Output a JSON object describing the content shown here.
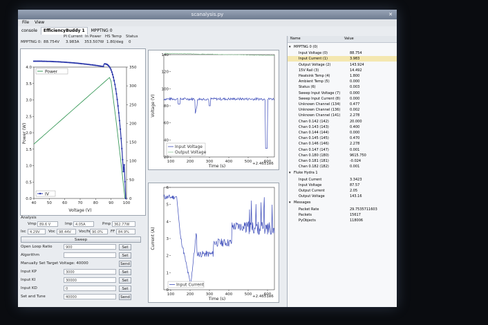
{
  "window": {
    "title": "scanalysis.py"
  },
  "menu": [
    "File",
    "View"
  ],
  "tabs": [
    "console",
    "EfficiencyBuddy 1",
    "MPPTNG 0"
  ],
  "status": {
    "headers": [
      "PI Current",
      "In Power",
      "HS Temp",
      "Status"
    ],
    "prefix": "MPPTNG 0:",
    "values": [
      "88.754V",
      "3.983A",
      "353.507W",
      "1.80/deg",
      "0"
    ]
  },
  "plot_pv": {
    "legend_power": "Power",
    "legend_iv": "IV",
    "xlabel": "Voltage (V)",
    "ylabel": "Power (W)",
    "x_ticks": [
      "40",
      "50",
      "60",
      "70",
      "80",
      "90",
      "100"
    ],
    "y_left_ticks": [
      "0.0",
      "0.5",
      "1.0",
      "1.5",
      "2.0",
      "2.5",
      "3.0",
      "3.5",
      "4.0"
    ],
    "y_right_ticks": [
      "0",
      "50",
      "100",
      "150",
      "200",
      "250",
      "300",
      "350"
    ]
  },
  "plot_voltage": {
    "ylabel": "Voltage (V)",
    "xlabel": "Time (s)",
    "y_ticks": [
      "20",
      "40",
      "60",
      "80",
      "100",
      "120",
      "140"
    ],
    "x_ticks": [
      "100",
      "200",
      "300",
      "400",
      "500",
      "600"
    ],
    "offset": "+2.4651e6",
    "legend": [
      "Input Voltage",
      "Output Voltage"
    ]
  },
  "plot_current": {
    "ylabel": "Current (A)",
    "xlabel": "Time (s)",
    "y_ticks": [
      "0",
      "1",
      "2",
      "3",
      "4",
      "5",
      "6"
    ],
    "x_ticks": [
      "100",
      "200",
      "300",
      "400",
      "500",
      "600"
    ],
    "offset": "+2.4651e6",
    "legend": [
      "Input Current"
    ]
  },
  "analysis": {
    "title": "Analysis",
    "vmp_label": "Vmp",
    "vmp": "89.6 V",
    "imp_label": "Imp",
    "imp": "4.05A",
    "pmp_label": "Pmp",
    "pmp": "362.77W",
    "isc_label": "Isc",
    "isc": "4.29V",
    "voc_label": "Voc",
    "voc": "98.44V",
    "vocfs_label": "Voc/fs",
    "vocfs": "90.0%",
    "ff_label": "FF",
    "ff": "84.9%",
    "sweep_label": "Sweep"
  },
  "controls": [
    {
      "label": "Open Loop Ratio",
      "value": "900",
      "button": "Set"
    },
    {
      "label": "Algorithm",
      "value": "",
      "button": "Set"
    },
    {
      "label": "Manually Set Target Voltage: 40000",
      "value": "",
      "button": "Send"
    },
    {
      "label": "Input KP",
      "value": "3000",
      "button": "Set"
    },
    {
      "label": "Input KI",
      "value": "30000",
      "button": "Set"
    },
    {
      "label": "Input KD",
      "value": "0",
      "button": "Set"
    },
    {
      "label": "Set and Tune",
      "value": "40000",
      "button": "Send"
    }
  ],
  "tree": {
    "col_name": "Name",
    "col_value": "Value",
    "groups": [
      {
        "name": "MPPTNG 0 (0)",
        "items": [
          [
            "Input Voltage (0)",
            "88.754"
          ],
          [
            "Input Current (1)",
            "3.983"
          ],
          [
            "Output Voltage (2)",
            "143.924"
          ],
          [
            "15V Rail (3)",
            "14.492"
          ],
          [
            "Heatsink Temp (4)",
            "1.800"
          ],
          [
            "Ambient Temp (5)",
            "0.000"
          ],
          [
            "Status (6)",
            "0.003"
          ],
          [
            "Sweep Input Voltage (7)",
            "0.000"
          ],
          [
            "Sweep Input Current (8)",
            "0.000"
          ],
          [
            "Unknown Channel (134)",
            "0.477"
          ],
          [
            "Unknown Channel (136)",
            "0.002"
          ],
          [
            "Unknown Channel (141)",
            "2.278"
          ],
          [
            "Chan 0.142 (142)",
            "20.000"
          ],
          [
            "Chan 0.143 (143)",
            "0.400"
          ],
          [
            "Chan 0.144 (144)",
            "0.000"
          ],
          [
            "Chan 0.145 (145)",
            "0.470"
          ],
          [
            "Chan 0.146 (146)",
            "2.278"
          ],
          [
            "Chan 0.147 (147)",
            "0.001"
          ],
          [
            "Chan 0.180 (180)",
            "9615.750"
          ],
          [
            "Chan 0.181 (181)",
            "-0.024"
          ],
          [
            "Chan 0.182 (182)",
            "0.001"
          ]
        ]
      },
      {
        "name": "Fluke Hydra 1",
        "items": [
          [
            "Input Current",
            "3.3423"
          ],
          [
            "Input Voltage",
            "87.57"
          ],
          [
            "Output Current",
            "2.05"
          ],
          [
            "Output Voltage",
            "143.16"
          ]
        ]
      },
      {
        "name": "Messages",
        "items": [
          [
            "Packet Rate",
            "29.7535711603"
          ],
          [
            "Packets",
            "15617"
          ],
          [
            "PyObjects",
            "118006"
          ]
        ]
      }
    ]
  },
  "colors": {
    "power": "#3a9a5a",
    "iv": "#2633a8",
    "highlight": "#f4e7b0"
  }
}
